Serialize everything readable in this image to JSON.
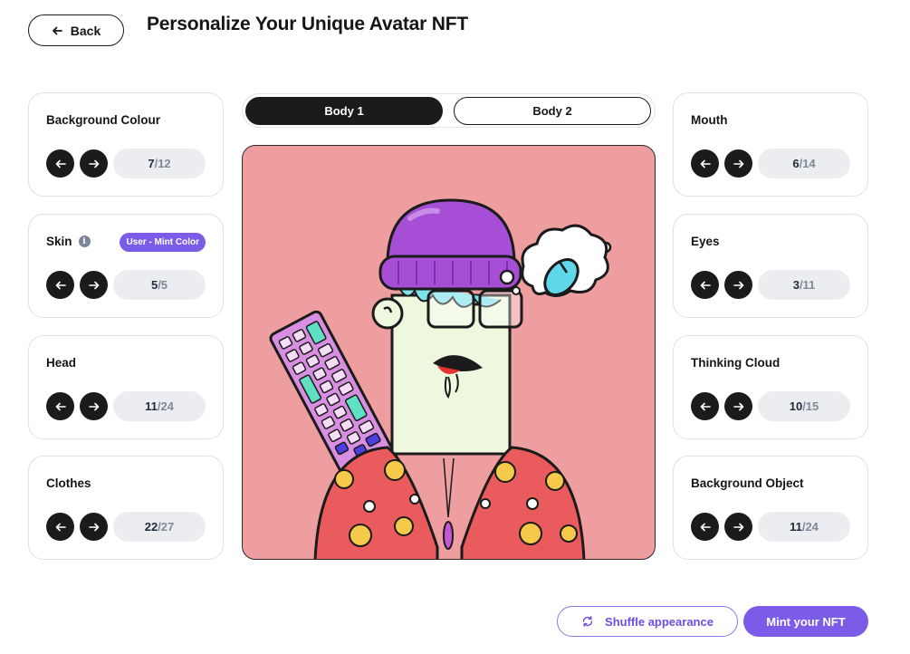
{
  "header": {
    "back_label": "Back",
    "title": "Personalize Your Unique Avatar NFT"
  },
  "body_tabs": [
    {
      "label": "Body 1",
      "selected": true
    },
    {
      "label": "Body 2",
      "selected": false
    }
  ],
  "traits_left": [
    {
      "label": "Background Colour",
      "current": "7",
      "total": "/12"
    },
    {
      "label": "Skin",
      "current": "5",
      "total": "/5",
      "info_icon": "info-icon",
      "badge": "User - Mint Color"
    },
    {
      "label": "Head",
      "current": "11",
      "total": "/24"
    },
    {
      "label": "Clothes",
      "current": "22",
      "total": "/27"
    }
  ],
  "traits_right": [
    {
      "label": "Mouth",
      "current": "6",
      "total": "/14"
    },
    {
      "label": "Eyes",
      "current": "3",
      "total": "/11"
    },
    {
      "label": "Thinking Cloud",
      "current": "10",
      "total": "/15"
    },
    {
      "label": "Background Object",
      "current": "11",
      "total": "/24"
    }
  ],
  "icons": {
    "back": "arrow-left-icon",
    "prev": "arrow-left-icon",
    "next": "arrow-right-icon",
    "shuffle": "refresh-icon",
    "info": "info-icon"
  },
  "avatar": {
    "background_color": "#ef9ea0",
    "skin_color": "#eef8de",
    "beanie_color": "#a64fd6",
    "jacket_color": "#ea5b5d",
    "keyboard_color": "#d88fe2",
    "cloud_object": "computer-mouse"
  },
  "actions": {
    "shuffle_label": "Shuffle appearance",
    "mint_label": "Mint your NFT"
  },
  "colors": {
    "accent": "#7b5ce8",
    "dark": "#1b1b1b",
    "counter_bg": "#ebedf0"
  }
}
